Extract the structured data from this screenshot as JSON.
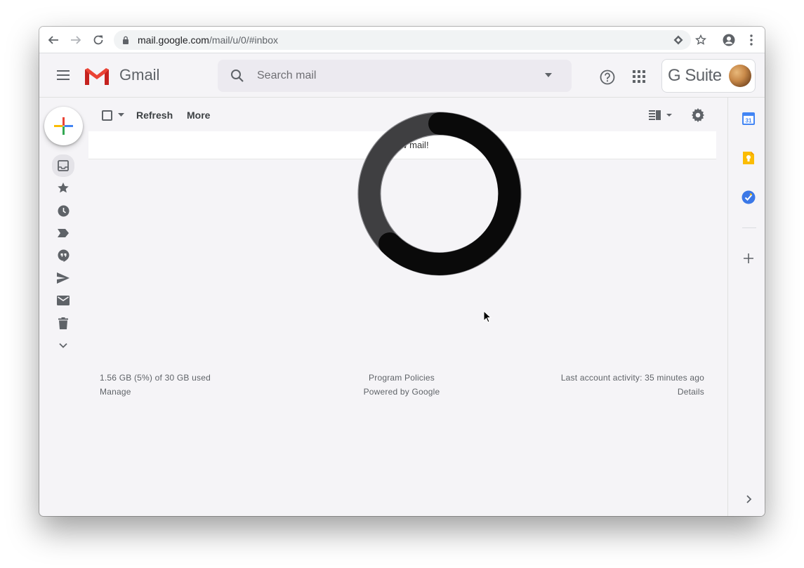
{
  "browser": {
    "url_host": "mail.google.com",
    "url_path": "/mail/u/0/#inbox"
  },
  "header": {
    "app_name": "Gmail",
    "search_placeholder": "Search mail",
    "gsuite_label": "G Suite"
  },
  "toolbar": {
    "refresh_label": "Refresh",
    "more_label": "More"
  },
  "mail": {
    "empty_message": "No new mail!"
  },
  "footer": {
    "storage_text": "1.56 GB (5%) of 30 GB used",
    "manage_label": "Manage",
    "policies_label": "Program Policies",
    "powered_label": "Powered by Google",
    "activity_text": "Last account activity: 35 minutes ago",
    "details_label": "Details"
  },
  "side_panel": {
    "calendar_day": "31"
  },
  "left_rail": {
    "items": [
      "inbox-icon",
      "star-icon",
      "clock-icon",
      "label-icon",
      "hangouts-icon",
      "send-icon",
      "mail-icon",
      "trash-icon",
      "chevron-down-icon"
    ]
  },
  "colors": {
    "gmail_red": "#ea4335",
    "calendar_blue": "#4285f4",
    "keep_yellow": "#fbbc04",
    "tasks_blue": "#3b78e7",
    "spinner_dark": "#0a0a0a",
    "spinner_light": "#3f3f41"
  }
}
